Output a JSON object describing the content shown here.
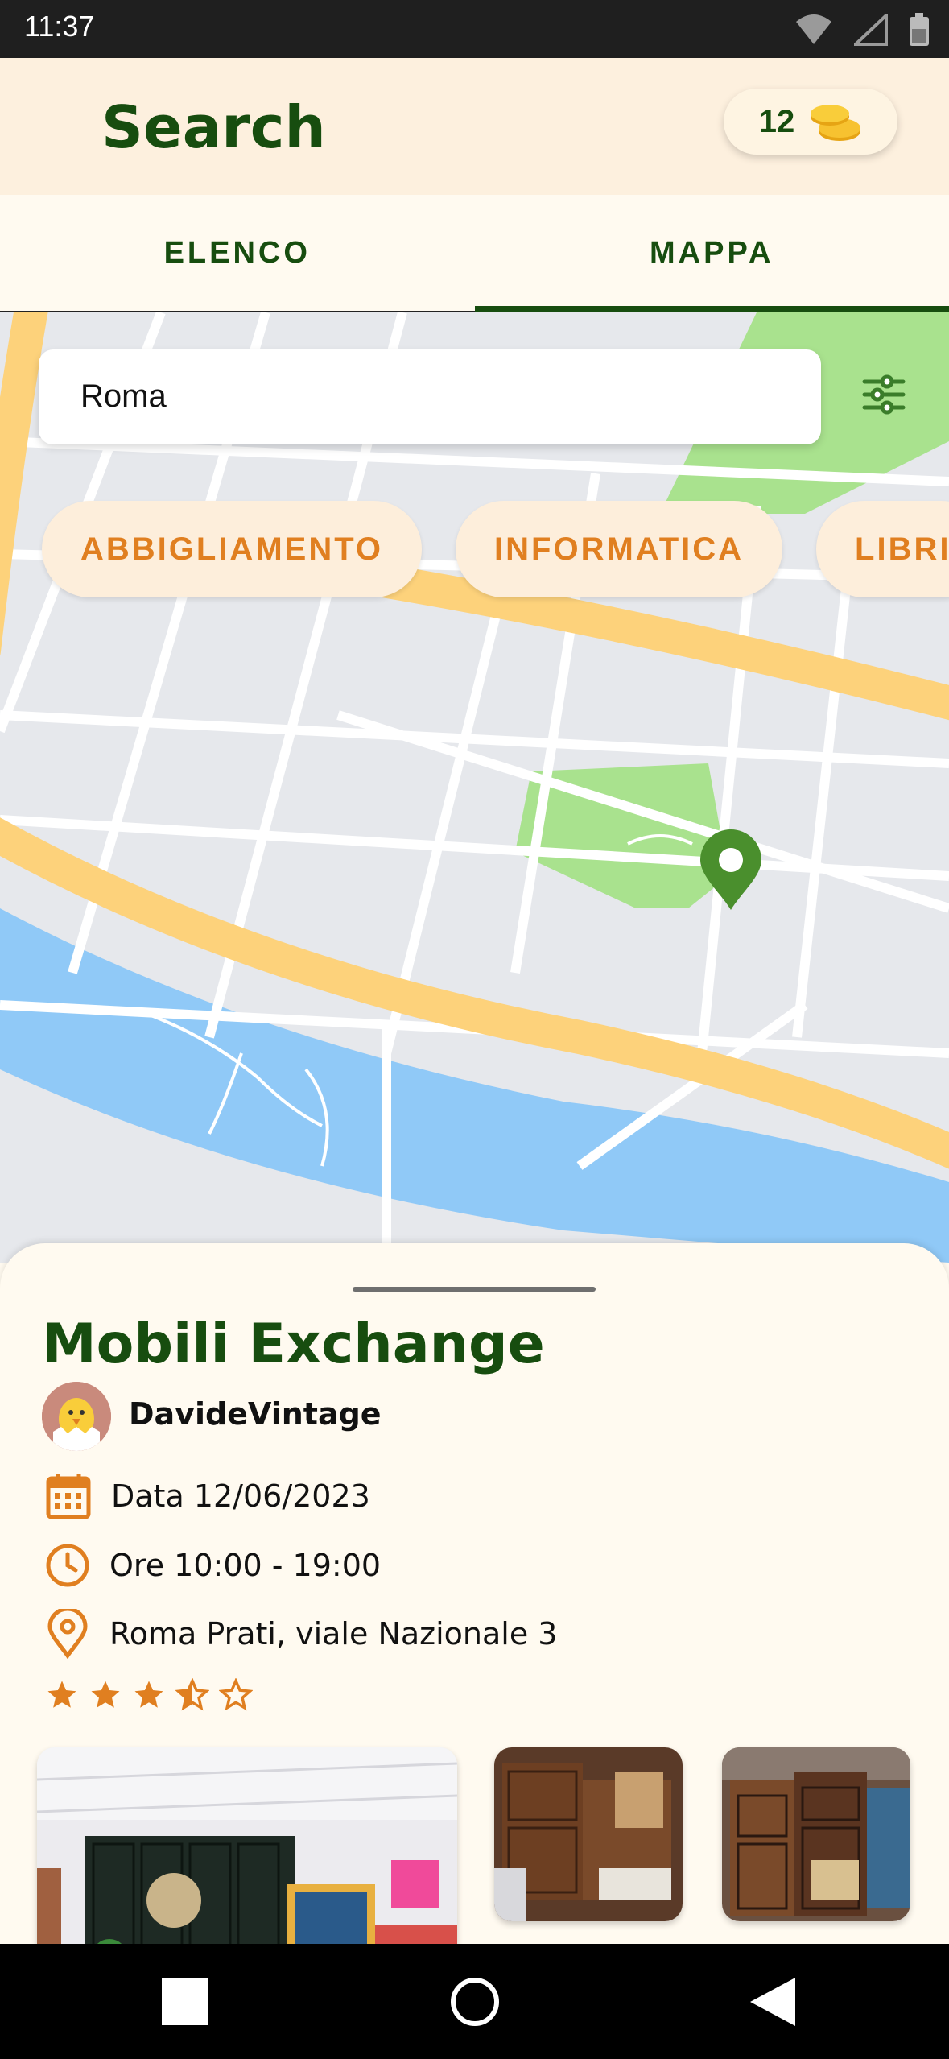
{
  "status_bar": {
    "time": "11:37"
  },
  "app_bar": {
    "title": "Search",
    "coins": "12"
  },
  "tabs": [
    {
      "label": "ELENCO",
      "active": false
    },
    {
      "label": "MAPPA",
      "active": true
    }
  ],
  "search": {
    "value": "Roma"
  },
  "categories": [
    "ABBIGLIAMENTO",
    "INFORMATICA",
    "LIBRI"
  ],
  "event": {
    "title": "Mobili Exchange",
    "organizer": "DavideVintage",
    "date": "Data 12/06/2023",
    "hours": "Ore 10:00 - 19:00",
    "location": "Roma Prati, viale Nazionale 3",
    "rating": 3.5,
    "rating_max": 5
  },
  "colors": {
    "primary_green": "#174d0f",
    "accent_orange": "#e07f20",
    "map_park": "#a9e28e",
    "map_water": "#90c9f7",
    "map_major_road": "#fdd27b"
  }
}
